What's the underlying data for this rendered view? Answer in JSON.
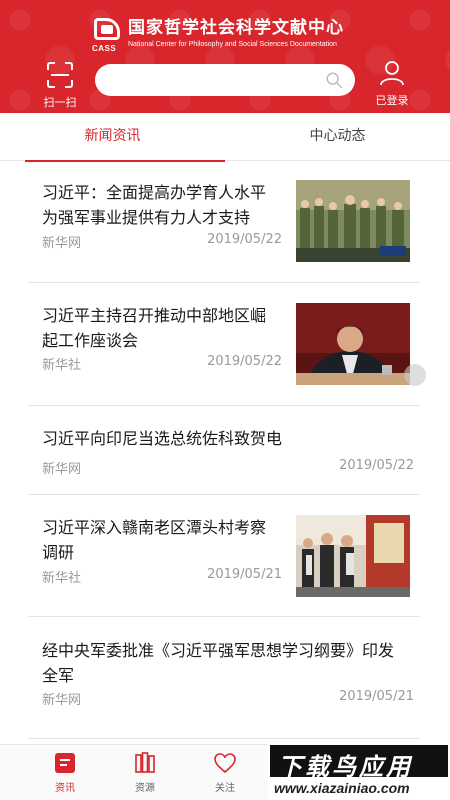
{
  "header": {
    "logo_cn": "国家哲学社会科学文献中心",
    "logo_en": "National Center for Philosophy and Social Sciences Documentation",
    "logo_abbr": "CASS",
    "scan_label": "扫一扫",
    "search_placeholder": "",
    "user_label": "已登录",
    "brand_color": "#d8262c"
  },
  "tabs": [
    {
      "label": "新闻资讯",
      "active": true
    },
    {
      "label": "中心动态",
      "active": false
    }
  ],
  "news": [
    {
      "title_lines": [
        "习近平：全面提高办学育人水平",
        "为强军事业提供有力人才支持"
      ],
      "source": "新华网",
      "date": "2019/05/22",
      "has_thumb": true
    },
    {
      "title_lines": [
        "习近平主持召开推动中部地区崛",
        "起工作座谈会"
      ],
      "source": "新华社",
      "date": "2019/05/22",
      "has_thumb": true
    },
    {
      "title_lines": [
        "习近平向印尼当选总统佐科致贺电"
      ],
      "source": "新华网",
      "date": "2019/05/22",
      "has_thumb": false
    },
    {
      "title_lines": [
        "习近平深入赣南老区潭头村考察",
        "调研"
      ],
      "source": "新华社",
      "date": "2019/05/21",
      "has_thumb": true
    },
    {
      "title_lines": [
        "经中央军委批准《习近平强军思想学习纲要》印发",
        "全军"
      ],
      "source": "新华网",
      "date": "2019/05/21",
      "has_thumb": false
    }
  ],
  "bottom_nav": [
    {
      "label": "资讯",
      "icon": "news-icon",
      "active": true
    },
    {
      "label": "资源",
      "icon": "books-icon",
      "active": false
    },
    {
      "label": "关注",
      "icon": "heart-icon",
      "active": false
    }
  ],
  "watermark": {
    "top": "下载鸟应用",
    "bottom": "www.xiazainiao.com"
  }
}
